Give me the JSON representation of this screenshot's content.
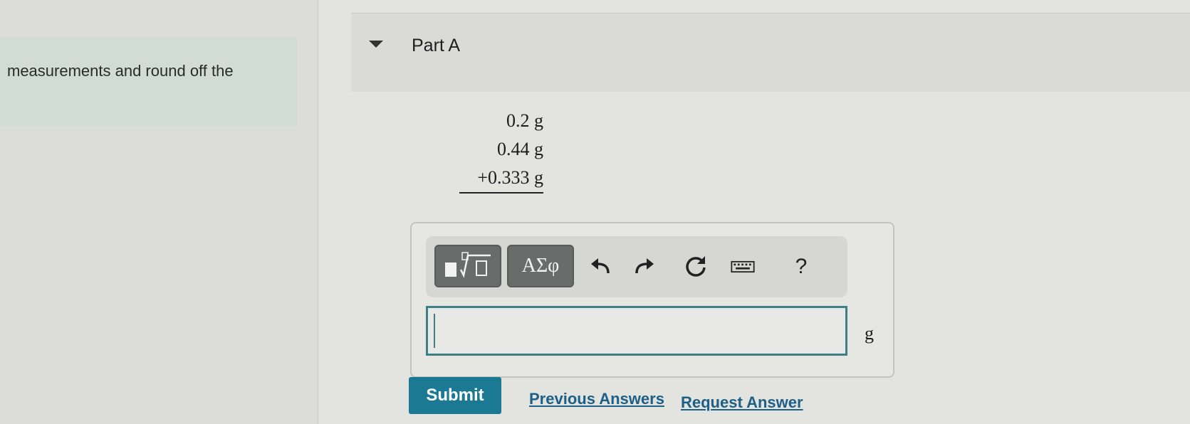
{
  "intro": {
    "text": "measurements and round off the"
  },
  "part": {
    "title": "Part A"
  },
  "expression": {
    "lines": [
      "0.2 g",
      "0.44 g",
      "+0.333 g"
    ]
  },
  "toolbar": {
    "templates_icon": "templates-icon",
    "symbols_label": "ΑΣφ",
    "help_label": "?"
  },
  "answer": {
    "value": "",
    "unit": "g"
  },
  "actions": {
    "submit_label": "Submit",
    "previous_answers_label": "Previous Answers",
    "request_answer_label": "Request Answer"
  },
  "colors": {
    "accent": "#1c7994",
    "link": "#1d5f86",
    "input_border": "#3e7f86"
  }
}
